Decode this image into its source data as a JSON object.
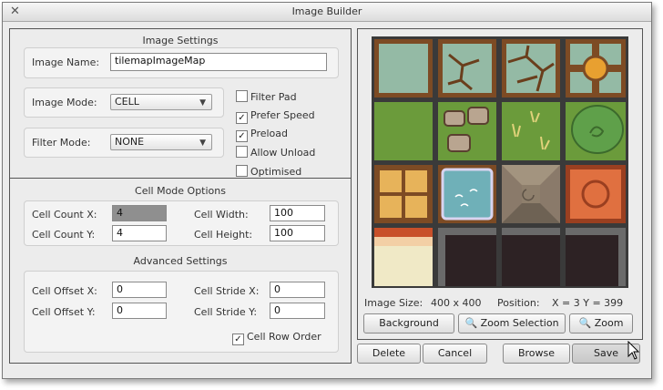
{
  "window": {
    "title": "Image Builder"
  },
  "image_settings": {
    "header": "Image Settings",
    "image_name_label": "Image Name:",
    "image_name_value": "tilemapImageMap",
    "image_mode_label": "Image Mode:",
    "image_mode_value": "CELL",
    "filter_mode_label": "Filter Mode:",
    "filter_mode_value": "NONE",
    "checkboxes": [
      {
        "label": "Filter Pad",
        "checked": false
      },
      {
        "label": "Prefer Speed",
        "checked": true
      },
      {
        "label": "Preload",
        "checked": true
      },
      {
        "label": "Allow Unload",
        "checked": false
      },
      {
        "label": "Optimised",
        "checked": false
      }
    ]
  },
  "cell_mode": {
    "header": "Cell Mode Options",
    "count_x_label": "Cell Count X:",
    "count_x_value": "4",
    "count_y_label": "Cell Count Y:",
    "count_y_value": "4",
    "width_label": "Cell Width:",
    "width_value": "100",
    "height_label": "Cell Height:",
    "height_value": "100"
  },
  "advanced": {
    "header": "Advanced Settings",
    "offset_x_label": "Cell Offset X:",
    "offset_x_value": "0",
    "offset_y_label": "Cell Offset Y:",
    "offset_y_value": "0",
    "stride_x_label": "Cell Stride X:",
    "stride_x_value": "0",
    "stride_y_label": "Cell Stride Y:",
    "stride_y_value": "0",
    "row_order_label": "Cell Row Order",
    "row_order_checked": true
  },
  "preview": {
    "size_label": "Image Size:",
    "size_value": "400 x 400",
    "position_label": "Position:",
    "position_value": "X = 3  Y = 399",
    "background_button": "Background",
    "zoom_selection_button": "Zoom Selection",
    "zoom_button": "Zoom"
  },
  "footer": {
    "delete": "Delete",
    "cancel": "Cancel",
    "browse": "Browse",
    "save": "Save"
  },
  "colors": {
    "grass": "#6a9a3a",
    "stone": "#8fb8a0",
    "wood": "#8a5a2a",
    "dark": "#2a2224"
  }
}
